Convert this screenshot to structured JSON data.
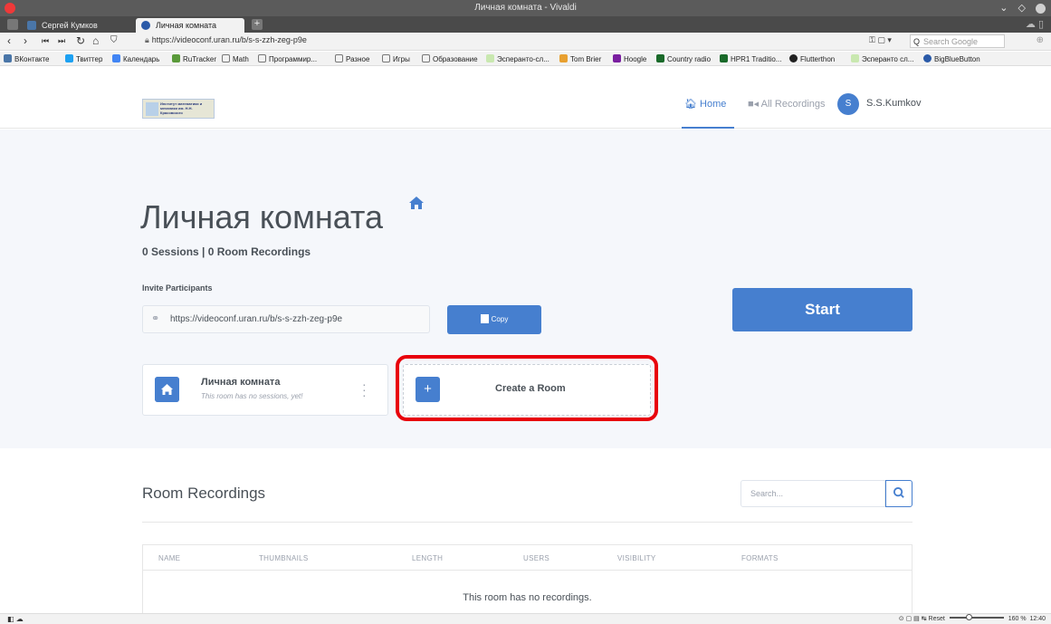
{
  "window": {
    "title": "Личная комната - Vivaldi"
  },
  "tabs": [
    {
      "label": "Сергей Кумков"
    },
    {
      "label": "Личная комната"
    }
  ],
  "address": {
    "url": "https://videoconf.uran.ru/b/s-s-zzh-zeg-p9e",
    "search_placeholder": "Search Google"
  },
  "bookmarks": [
    "ВКонтакте",
    "Твиттер",
    "Календарь",
    "RuTracker",
    "Math",
    "Программир...",
    "Разное",
    "Игры",
    "Образование",
    "Эсперанто-сл...",
    "Tom Brier",
    "Hoogle",
    "Country radio",
    "HPR1 Traditio...",
    "Flutterthon",
    "Эсперанто сл...",
    "BigBlueButton"
  ],
  "navbar": {
    "logo_text": "Институт математики и механики им. Н.Н. Красовского",
    "home": "Home",
    "all_recordings": "All Recordings",
    "avatar_initial": "S",
    "username": "S.S.Kumkov"
  },
  "room": {
    "title": "Личная комната",
    "stats": "0 Sessions | 0 Room Recordings",
    "invite_label": "Invite Participants",
    "invite_url": "https://videoconf.uran.ru/b/s-s-zzh-zeg-p9e",
    "copy_label": "Copy",
    "start_label": "Start"
  },
  "room_card": {
    "name": "Личная комната",
    "subtitle": "This room has no sessions, yet!"
  },
  "create_room": {
    "label": "Create a Room"
  },
  "recordings": {
    "title": "Room Recordings",
    "search_placeholder": "Search...",
    "columns": [
      "NAME",
      "THUMBNAILS",
      "LENGTH",
      "USERS",
      "VISIBILITY",
      "FORMATS"
    ],
    "empty": "This room has no recordings."
  },
  "statusbar": {
    "reset": "Reset",
    "zoom": "160 %",
    "time": "12:40"
  },
  "colors": {
    "accent": "#467fcf",
    "highlight": "#e8000b"
  }
}
